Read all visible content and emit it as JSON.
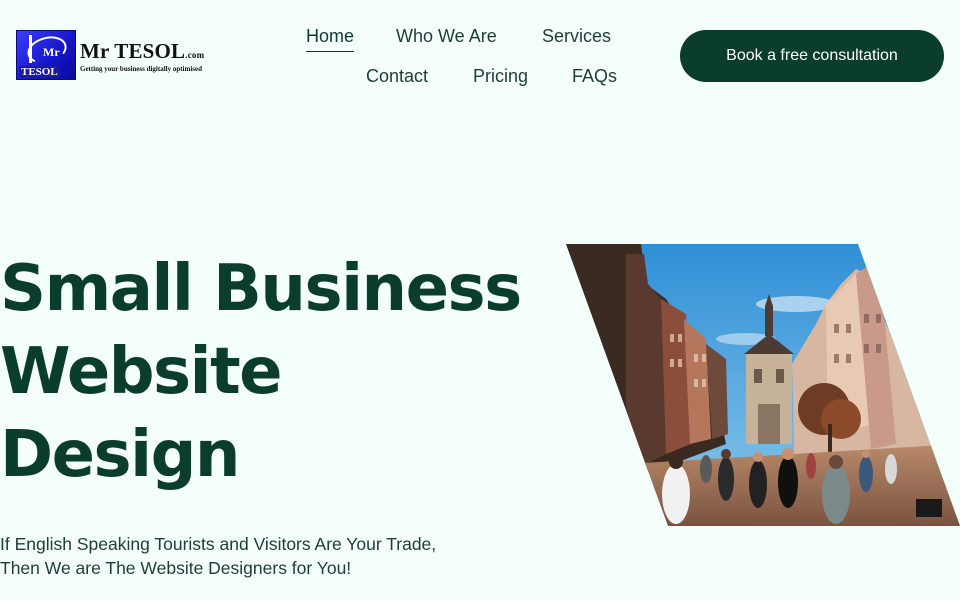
{
  "brand": {
    "logo_mark_top": "Mr",
    "logo_mark_bottom": "TESOL",
    "name": "Mr TESOL",
    "domain": ".com",
    "tagline": "Getting your business digitally optimised"
  },
  "nav": {
    "items": [
      {
        "label": "Home",
        "active": true
      },
      {
        "label": "Who We Are"
      },
      {
        "label": "Services"
      },
      {
        "label": "Contact"
      },
      {
        "label": "Pricing"
      },
      {
        "label": "FAQs"
      }
    ]
  },
  "cta": {
    "label": "Book a free consultation"
  },
  "hero": {
    "title_lines": [
      "Small Business",
      "Website",
      "Design"
    ],
    "subtitle": "If English Speaking Tourists and Visitors Are Your Trade, Then We are The Website Designers for You!",
    "image_icon": "city-street-photo"
  },
  "colors": {
    "background": "#f4fffb",
    "brand_dark_green": "#0b3d2c",
    "text": "#1f3d34",
    "logo_blue": "#1515c8"
  }
}
